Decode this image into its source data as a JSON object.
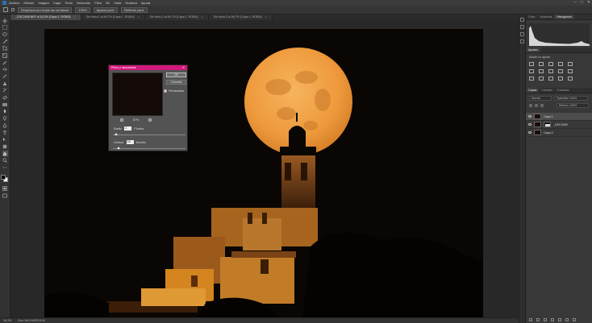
{
  "menubar": {
    "items": [
      "Archivo",
      "Edición",
      "Imagen",
      "Capa",
      "Texto",
      "Selección",
      "Filtro",
      "3D",
      "Vista",
      "Ventana",
      "Ayuda"
    ]
  },
  "options": {
    "sample_all": "Desplazar por todas las ventanas",
    "zoom": "100%",
    "fit_screen": "Ajustar pant.",
    "fill_screen": "Rellenar pant."
  },
  "tabs": [
    {
      "label": "_DSC2405.NEF al 16,3% (Capa 1, RGB/8)",
      "active": true
    },
    {
      "label": "Sin título-1 al 66,7% (Capa 1, RGB/8)",
      "active": false
    },
    {
      "label": "Sin título-2 al 66,7% (Capa 2, RGB/8)",
      "active": false
    },
    {
      "label": "Sin título-3 al 66,7% (Capa 1, RGB/8)",
      "active": false
    }
  ],
  "statusbar": {
    "zoom": "16,3%",
    "doc_info": "Doc: 68,9 M/203,6 M"
  },
  "panels": {
    "top_tabs": [
      "Color",
      "Muestras",
      "Histograma"
    ],
    "adjust_tabs": [
      "Ajustes"
    ],
    "adjust_label": "Añadir un ajuste",
    "layer_tabs": [
      "Capas",
      "Canales",
      "Trazados"
    ],
    "blend_mode": "Normal",
    "opacity_label": "Opacidad: 100%",
    "fill_label": "Relleno: 100%",
    "layers": [
      {
        "name": "Capa 1",
        "selected": true,
        "mask": false
      },
      {
        "name": "_DSC2405",
        "selected": false,
        "mask": true
      },
      {
        "name": "Capa 0",
        "selected": false,
        "mask": false
      }
    ]
  },
  "dialog": {
    "title": "Polvo y rascaduras",
    "ok": "OK",
    "cancel": "Cancelar",
    "preview": "Previsualizar",
    "zoom": "67%",
    "radius_label": "Radio:",
    "radius_value": "1",
    "radius_unit": "Píxeles",
    "radius_level": 0.02,
    "threshold_label": "Umbral:",
    "threshold_value": "16",
    "threshold_unit": "Niveles",
    "threshold_level": 0.06
  },
  "colors": {
    "dialog_title": "#d1187c",
    "moon": "#f0a145",
    "night_sky": "#0a0604",
    "building_light": "#d4851f"
  }
}
